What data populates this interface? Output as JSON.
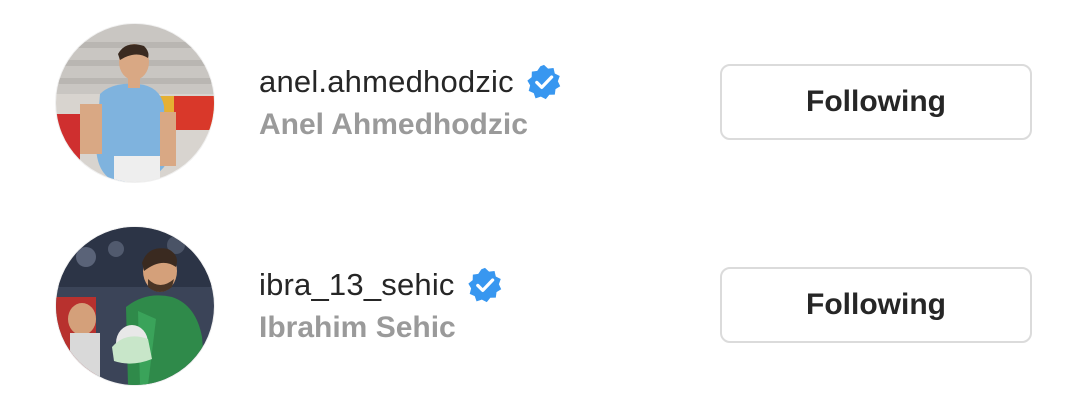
{
  "accounts": [
    {
      "username": "anel.ahmedhodzic",
      "full_name": "Anel Ahmedhodzic",
      "verified": true,
      "follow_button_label": "Following",
      "avatar_icon": "profile-photo"
    },
    {
      "username": "ibra_13_sehic",
      "full_name": "Ibrahim Sehic",
      "verified": true,
      "follow_button_label": "Following",
      "avatar_icon": "profile-photo"
    }
  ],
  "colors": {
    "verified_badge": "#3897f0",
    "username_text": "#262626",
    "fullname_text": "#9a9a9a",
    "button_border": "#dbdbdb"
  }
}
